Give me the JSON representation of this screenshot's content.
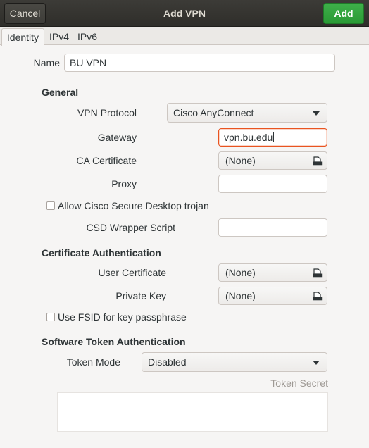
{
  "window": {
    "title": "Add VPN",
    "cancel_label": "Cancel",
    "add_label": "Add"
  },
  "tabs": [
    "Identity",
    "IPv4",
    "IPv6"
  ],
  "identity": {
    "name_label": "Name",
    "name_value": "BU VPN"
  },
  "general": {
    "heading": "General",
    "vpn_protocol_label": "VPN Protocol",
    "vpn_protocol_value": "Cisco AnyConnect",
    "gateway_label": "Gateway",
    "gateway_value": "vpn.bu.edu",
    "ca_certificate_label": "CA Certificate",
    "ca_certificate_value": "(None)",
    "proxy_label": "Proxy",
    "proxy_value": "",
    "csd_trojan_label": "Allow Cisco Secure Desktop trojan",
    "csd_trojan_checked": false,
    "csd_wrapper_label": "CSD Wrapper Script",
    "csd_wrapper_value": ""
  },
  "cert_auth": {
    "heading": "Certificate Authentication",
    "user_cert_label": "User Certificate",
    "user_cert_value": "(None)",
    "private_key_label": "Private Key",
    "private_key_value": "(None)",
    "fsid_label": "Use FSID for key passphrase",
    "fsid_checked": false
  },
  "token_auth": {
    "heading": "Software Token Authentication",
    "token_mode_label": "Token Mode",
    "token_mode_value": "Disabled",
    "token_secret_label": "Token Secret",
    "token_secret_value": ""
  },
  "colors": {
    "accent": "#e95420",
    "add_button": "#3eb04a",
    "header_bg": "#3c3b37"
  },
  "icons": {
    "file_chooser": "document-open-icon",
    "combo_arrow": "chevron-down-icon"
  }
}
